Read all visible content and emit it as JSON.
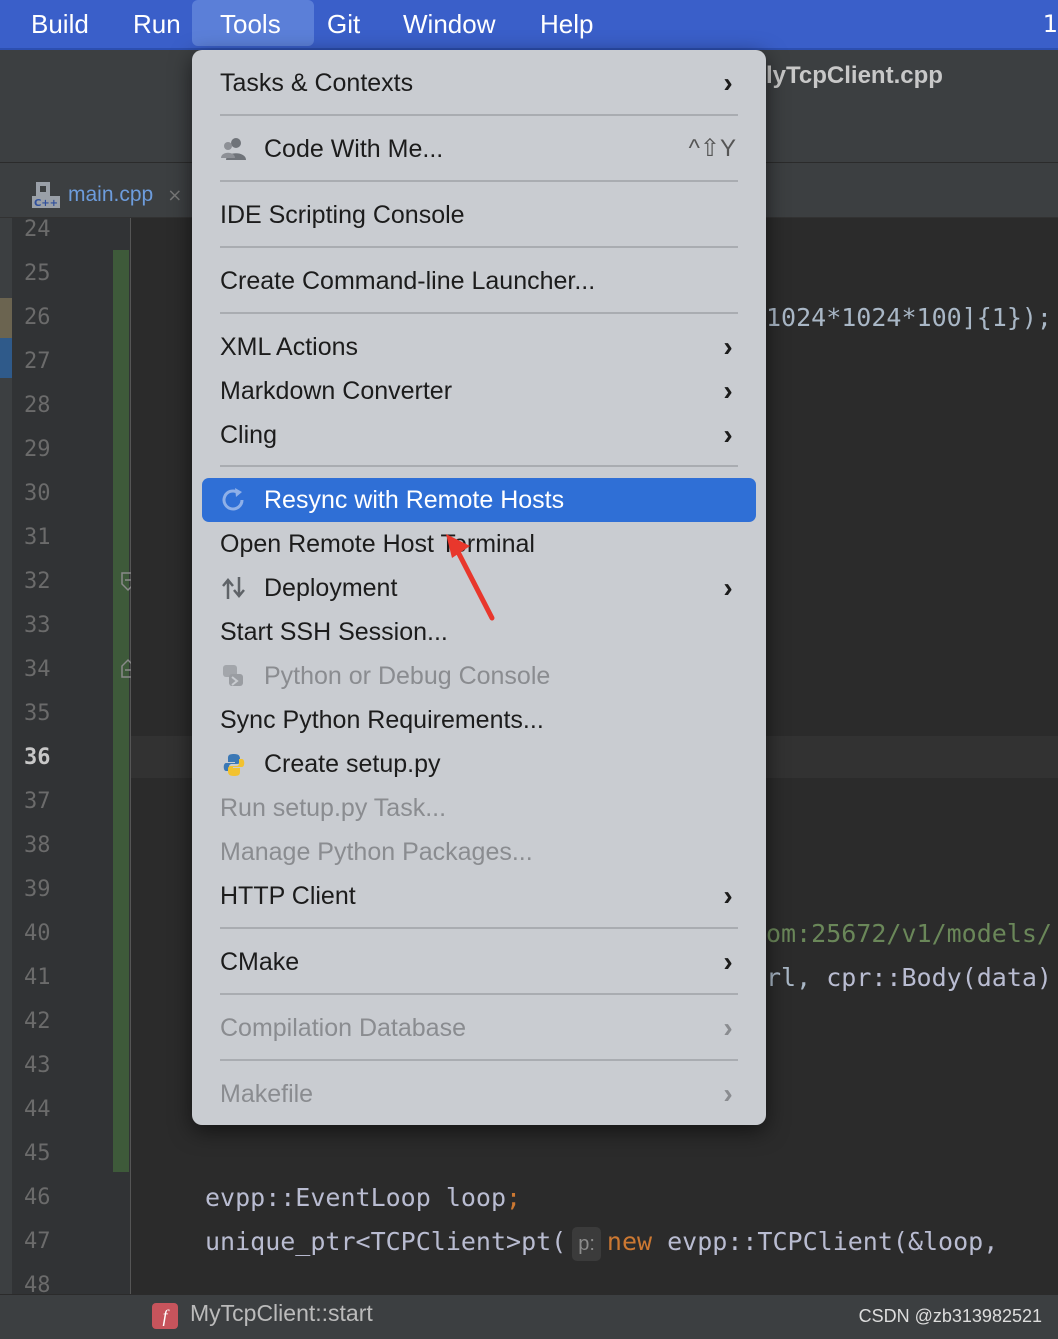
{
  "menubar": {
    "items": [
      "Build",
      "Run",
      "Tools",
      "Git",
      "Window",
      "Help"
    ],
    "active": "Tools",
    "right_fragment": "1"
  },
  "window": {
    "title_fragment": "lyTcpClient.cpp"
  },
  "tabs": [
    {
      "label": "main.cpp",
      "icon": "cpp-file-icon",
      "close": "×"
    }
  ],
  "gutter": {
    "line_numbers": [
      "24",
      "25",
      "26",
      "27",
      "28",
      "29",
      "30",
      "31",
      "32",
      "33",
      "34",
      "35",
      "36",
      "37",
      "38",
      "39",
      "40",
      "41",
      "42",
      "43",
      "44",
      "45",
      "46",
      "47",
      "48"
    ],
    "current_line": "36"
  },
  "editor": {
    "line26_tail": "1024*1024*100]{1});",
    "line40_tail": "om:25672/v1/models/",
    "line41_tail_a": "rl, ",
    "line41_tail_b": "cpr::Body(data)",
    "line46_a": "evpp::EventLoop loop",
    "line46_b": ";",
    "line47_a": "unique_ptr<TCPClient>pt(",
    "line47_hint": "p:",
    "line47_kw": "new",
    "line47_b": " evpp::TCPClient(&loop,"
  },
  "menu": {
    "items": {
      "tasks_contexts": "Tasks & Contexts",
      "code_with_me": "Code With Me...",
      "code_with_me_shortcut": "^⇧Y",
      "ide_scripting": "IDE Scripting Console",
      "cmdline_launcher": "Create Command-line Launcher...",
      "xml_actions": "XML Actions",
      "markdown_converter": "Markdown Converter",
      "cling": "Cling",
      "resync": "Resync with Remote Hosts",
      "open_remote_terminal": "Open Remote Host Terminal",
      "deployment": "Deployment",
      "start_ssh": "Start SSH Session...",
      "python_debug_console": "Python or Debug Console",
      "sync_python_req": "Sync Python Requirements...",
      "create_setup": "Create setup.py",
      "run_setup_task": "Run setup.py Task...",
      "manage_python_pkgs": "Manage Python Packages...",
      "http_client": "HTTP Client",
      "cmake": "CMake",
      "compilation_db": "Compilation Database",
      "makefile": "Makefile"
    },
    "arrow_glyph": "›"
  },
  "statusbar": {
    "crumb_icon_letter": "f",
    "crumb": "MyTcpClient::start",
    "watermark": "CSDN @zb313982521"
  },
  "colors": {
    "menubar": "#3a5fc9",
    "menu_bg": "#c9ccd1",
    "selection": "#2f6fd6",
    "annotation_arrow": "#e8372c"
  }
}
